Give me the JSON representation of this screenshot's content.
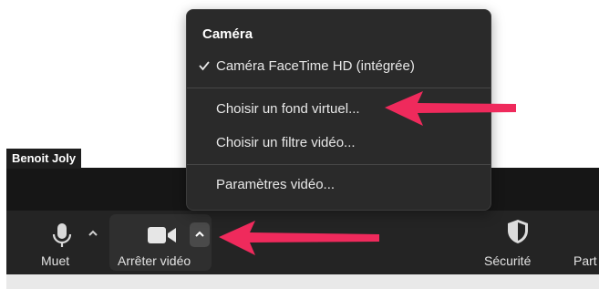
{
  "participant": {
    "name": "Benoit Joly"
  },
  "toolbar": {
    "mute_label": "Muet",
    "video_label": "Arrêter vidéo",
    "security_label": "Sécurité",
    "participants_label_partial": "Part"
  },
  "menu": {
    "title": "Caméra",
    "items": [
      {
        "label": "Caméra FaceTime HD (intégrée)",
        "checked": true
      },
      {
        "label": "Choisir un fond virtuel..."
      },
      {
        "label": "Choisir un filtre vidéo..."
      },
      {
        "label": "Paramètres vidéo..."
      }
    ]
  },
  "annotations": {
    "arrow_color": "#ef2a5c"
  },
  "icons": [
    "microphone-icon",
    "chevron-up-icon",
    "video-camera-icon",
    "shield-icon",
    "checkmark-icon",
    "arrow-annotation"
  ]
}
